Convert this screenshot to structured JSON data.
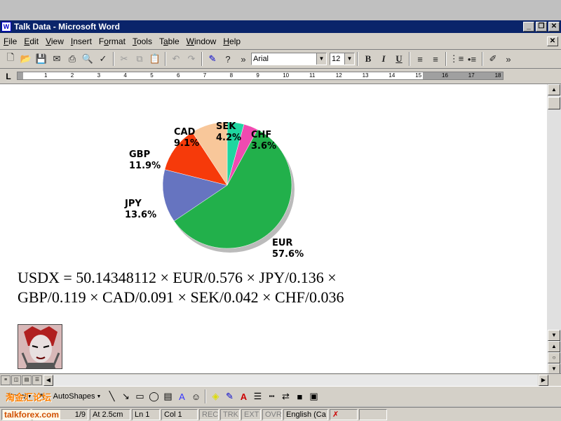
{
  "window": {
    "title": "Talk Data - Microsoft Word",
    "app_icon": "W",
    "minimize": "_",
    "restore": "❐",
    "close": "✕"
  },
  "menu": {
    "items": [
      {
        "pre": "",
        "ul": "F",
        "post": "ile"
      },
      {
        "pre": "",
        "ul": "E",
        "post": "dit"
      },
      {
        "pre": "",
        "ul": "V",
        "post": "iew"
      },
      {
        "pre": "",
        "ul": "I",
        "post": "nsert"
      },
      {
        "pre": "F",
        "ul": "o",
        "post": "rmat"
      },
      {
        "pre": "",
        "ul": "T",
        "post": "ools"
      },
      {
        "pre": "T",
        "ul": "a",
        "post": "ble"
      },
      {
        "pre": "",
        "ul": "W",
        "post": "indow"
      },
      {
        "pre": "",
        "ul": "H",
        "post": "elp"
      }
    ],
    "doc_close": "✕"
  },
  "toolbar": {
    "font_name": "Arial",
    "font_size": "12",
    "bold": "B",
    "italic": "I",
    "underline": "U",
    "more": "»"
  },
  "ruler": {
    "tab_selector": "L",
    "numbers": [
      "1",
      "2",
      "3",
      "4",
      "5",
      "6",
      "7",
      "8",
      "9",
      "10",
      "11",
      "12",
      "13",
      "14",
      "15",
      "16",
      "17",
      "18"
    ]
  },
  "chart_data": {
    "type": "pie",
    "slices": [
      {
        "label": "EUR",
        "value": 57.6,
        "text": "57.6%",
        "color": "#22b04b"
      },
      {
        "label": "JPY",
        "value": 13.6,
        "text": "13.6%",
        "color": "#6674c0"
      },
      {
        "label": "GBP",
        "value": 11.9,
        "text": "11.9%",
        "color": "#f63a0a"
      },
      {
        "label": "CAD",
        "value": 9.1,
        "text": "9.1%",
        "color": "#f8c79a"
      },
      {
        "label": "SEK",
        "value": 4.2,
        "text": "4.2%",
        "color": "#1fd6a0"
      },
      {
        "label": "CHF",
        "value": 3.6,
        "text": "3.6%",
        "color": "#f04ab0"
      }
    ]
  },
  "document": {
    "formula_line1": "USDX = 50.14348112 × EUR/0.576 × JPY/0.136 ×",
    "formula_line2": "GBP/0.119 × CAD/0.091 × SEK/0.042 × CHF/0.036"
  },
  "drawbar": {
    "draw_label": "Draw",
    "autoshapes_label": "AutoShapes"
  },
  "status": {
    "page": "1/9",
    "at": "At 2.5cm",
    "ln": "Ln 1",
    "col": "Col 1",
    "rec": "REC",
    "trk": "TRK",
    "ext": "EXT",
    "ovr": "OVR",
    "lang": "English (Ca"
  },
  "watermark": {
    "brand": "talkforex.com",
    "cn": "淘金汇论坛"
  }
}
